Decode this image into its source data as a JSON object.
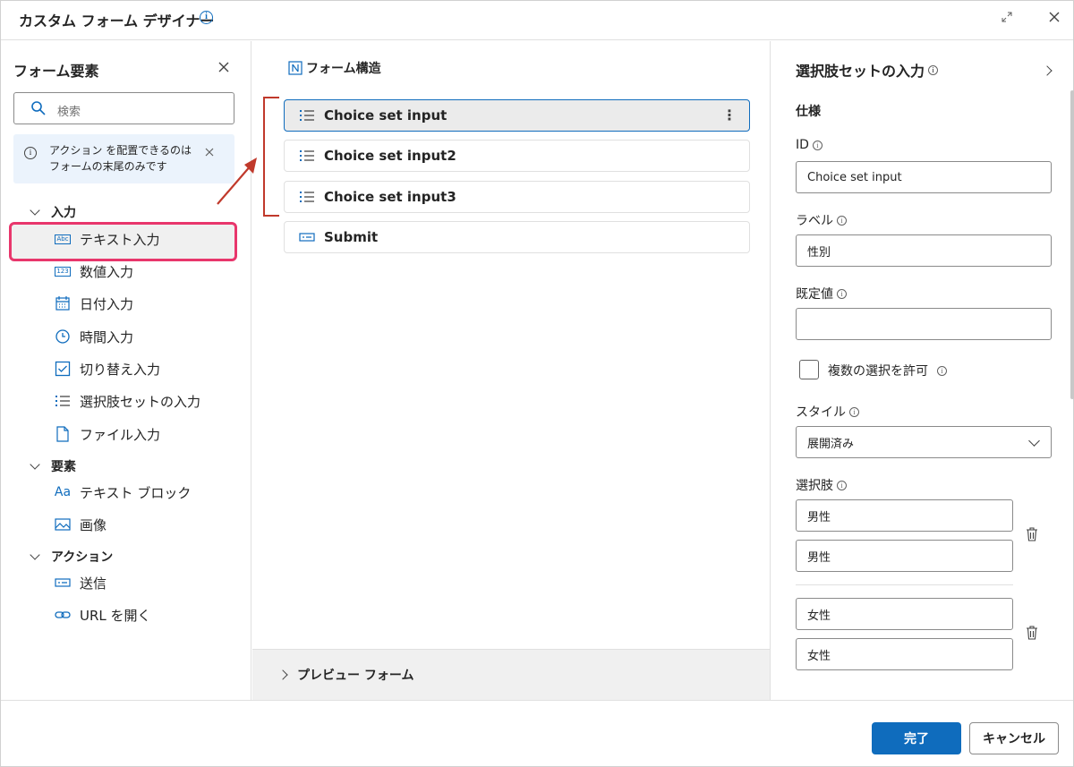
{
  "window": {
    "title": "カスタム フォーム デザイナー"
  },
  "left_panel": {
    "title": "フォーム要素",
    "search_placeholder": "検索",
    "message": "アクション を配置できるのはフォームの末尾のみです",
    "groups": [
      {
        "label": "入力",
        "items": [
          {
            "label": "テキスト入力",
            "icon": "text-input-icon",
            "icon_text": "Abc"
          },
          {
            "label": "数値入力",
            "icon": "number-input-icon",
            "icon_text": "123"
          },
          {
            "label": "日付入力",
            "icon": "calendar-icon"
          },
          {
            "label": "時間入力",
            "icon": "clock-icon"
          },
          {
            "label": "切り替え入力",
            "icon": "toggle-checkbox-icon"
          },
          {
            "label": "選択肢セットの入力",
            "icon": "list-icon"
          },
          {
            "label": "ファイル入力",
            "icon": "file-icon"
          }
        ]
      },
      {
        "label": "要素",
        "items": [
          {
            "label": "テキスト ブロック",
            "icon": "text-block-icon",
            "icon_text": "Aa"
          },
          {
            "label": "画像",
            "icon": "image-icon"
          }
        ]
      },
      {
        "label": "アクション",
        "items": [
          {
            "label": "送信",
            "icon": "submit-icon"
          },
          {
            "label": "URL を開く",
            "icon": "link-icon"
          }
        ]
      }
    ]
  },
  "middle_panel": {
    "title": "フォーム構造",
    "cards": [
      {
        "label": "Choice set input",
        "icon": "list-icon",
        "selected": true
      },
      {
        "label": "Choice set input2",
        "icon": "list-icon"
      },
      {
        "label": "Choice set input3",
        "icon": "list-icon"
      },
      {
        "label": "Submit",
        "icon": "submit-icon"
      }
    ],
    "kebab": "⋮",
    "preview_label": "プレビュー フォーム"
  },
  "right_panel": {
    "title": "選択肢セットの入力",
    "section": "仕様",
    "id_label": "ID",
    "id_value": "Choice set input",
    "label_label": "ラベル",
    "label_value": "性別",
    "default_label": "既定値",
    "default_value": "",
    "multi_select_label": "複数の選択を許可",
    "style_label": "スタイル",
    "style_value": "展開済み",
    "choices_label": "選択肢",
    "choices": [
      {
        "title": "男性",
        "value": "男性"
      },
      {
        "title": "女性",
        "value": "女性"
      }
    ]
  },
  "footer": {
    "done_label": "完了",
    "cancel_label": "キャンセル"
  },
  "colors": {
    "accent": "#0f6cbd",
    "highlight": "#e8366c",
    "annotation": "#c0392b"
  }
}
